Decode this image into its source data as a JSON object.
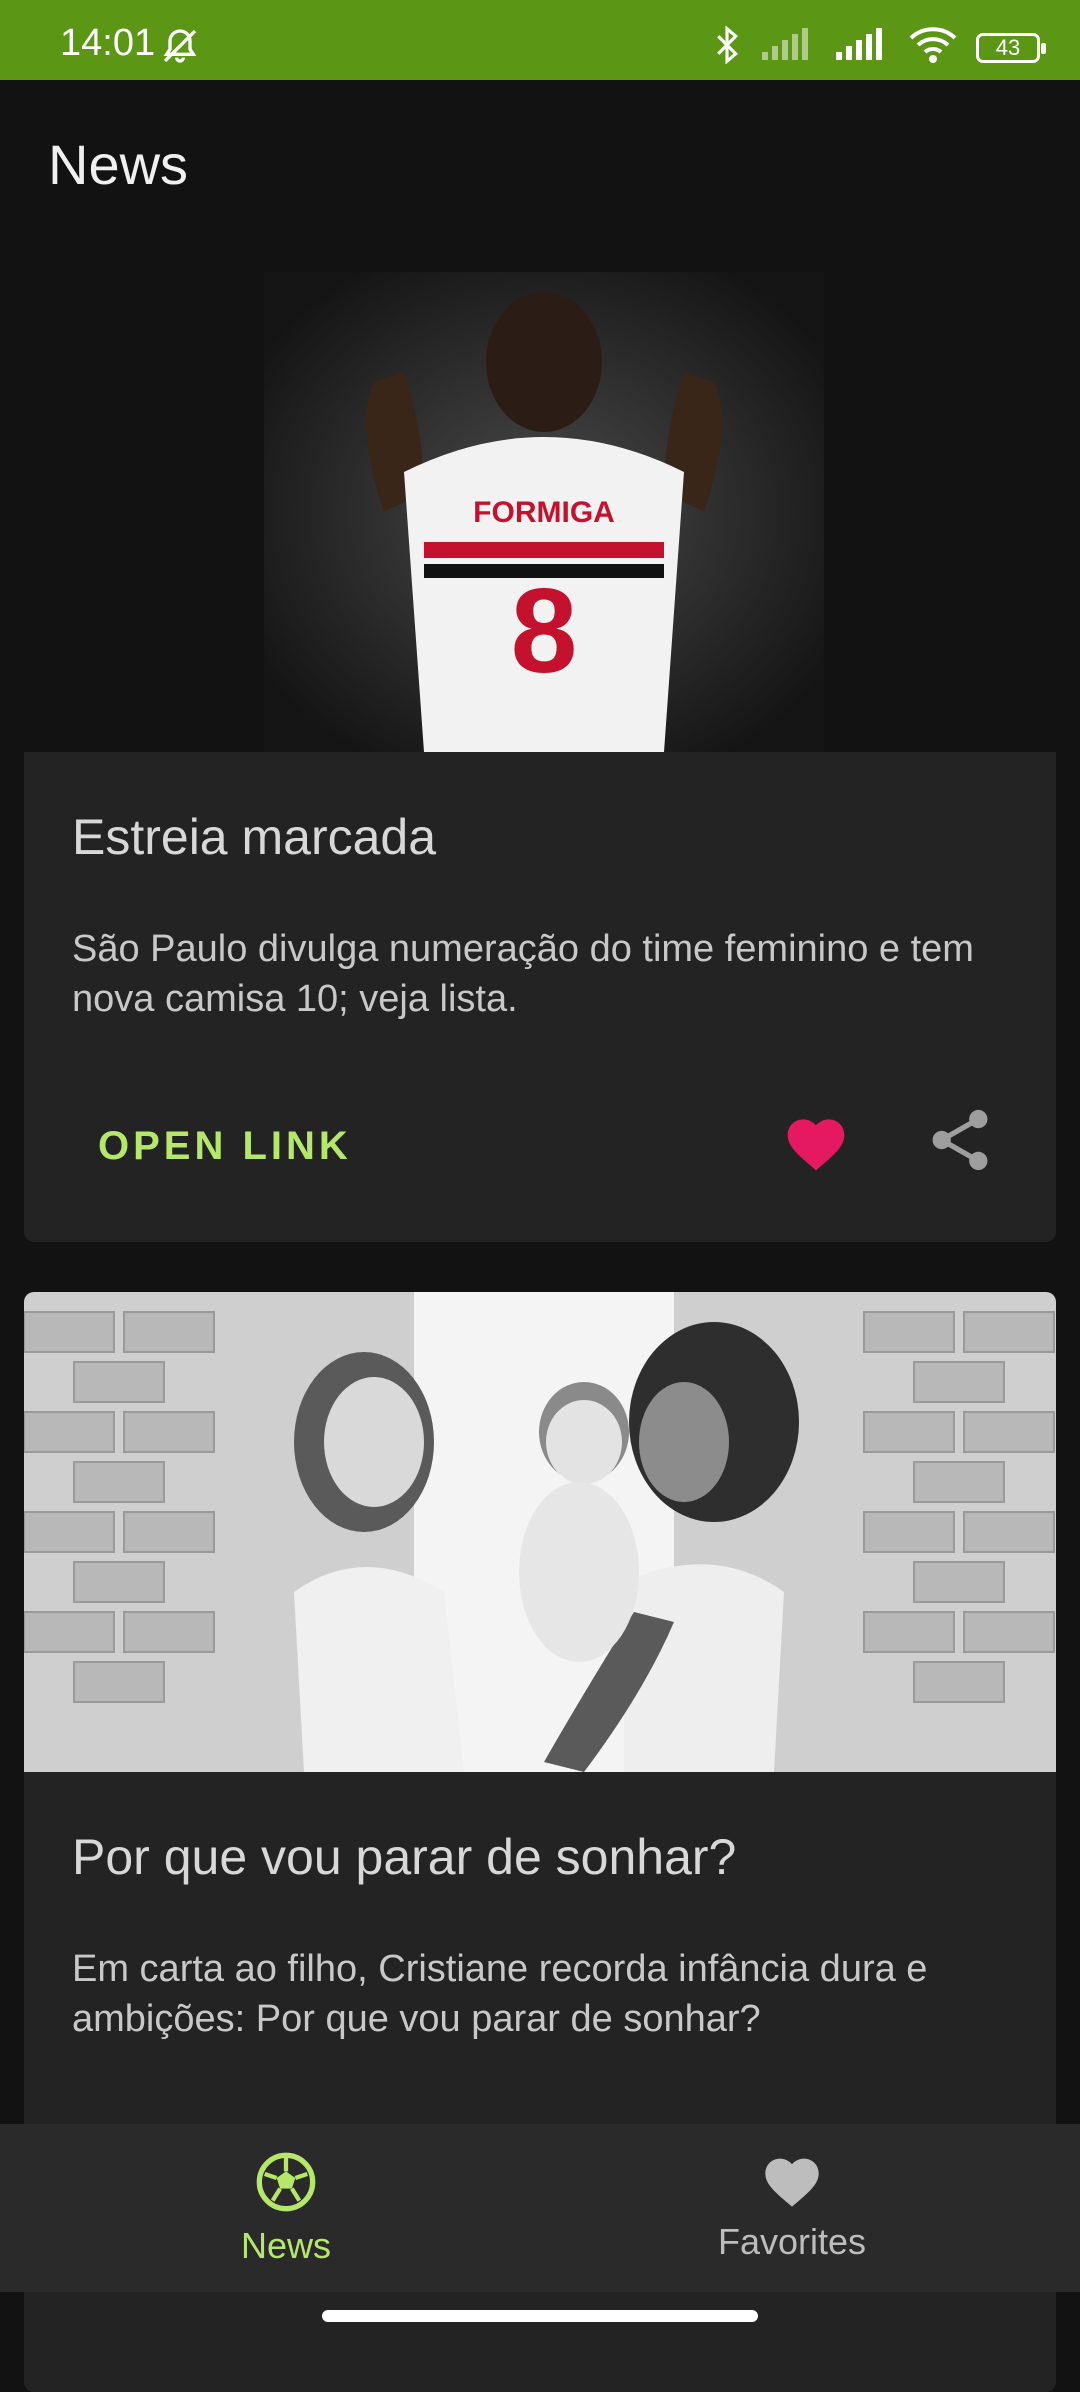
{
  "status_bar": {
    "time": "14:01",
    "battery": "43"
  },
  "app_bar": {
    "title": "News"
  },
  "articles": [
    {
      "title": "Estreia marcada",
      "description": "São Paulo divulga numeração do time feminino e tem nova camisa 10; veja lista.",
      "open_link_label": "OPEN LINK",
      "favorited": true
    },
    {
      "title": "Por que vou parar de sonhar?",
      "description": "Em carta ao filho, Cristiane recorda infância dura e ambições: Por que vou parar de sonhar?"
    }
  ],
  "bottom_nav": [
    {
      "label": "News",
      "icon": "soccer-ball-icon",
      "active": true
    },
    {
      "label": "Favorites",
      "icon": "heart-icon",
      "active": false
    }
  ],
  "colors": {
    "accent": "#b5e86a",
    "status_bar": "#5c9615",
    "favorite": "#e5195f"
  }
}
